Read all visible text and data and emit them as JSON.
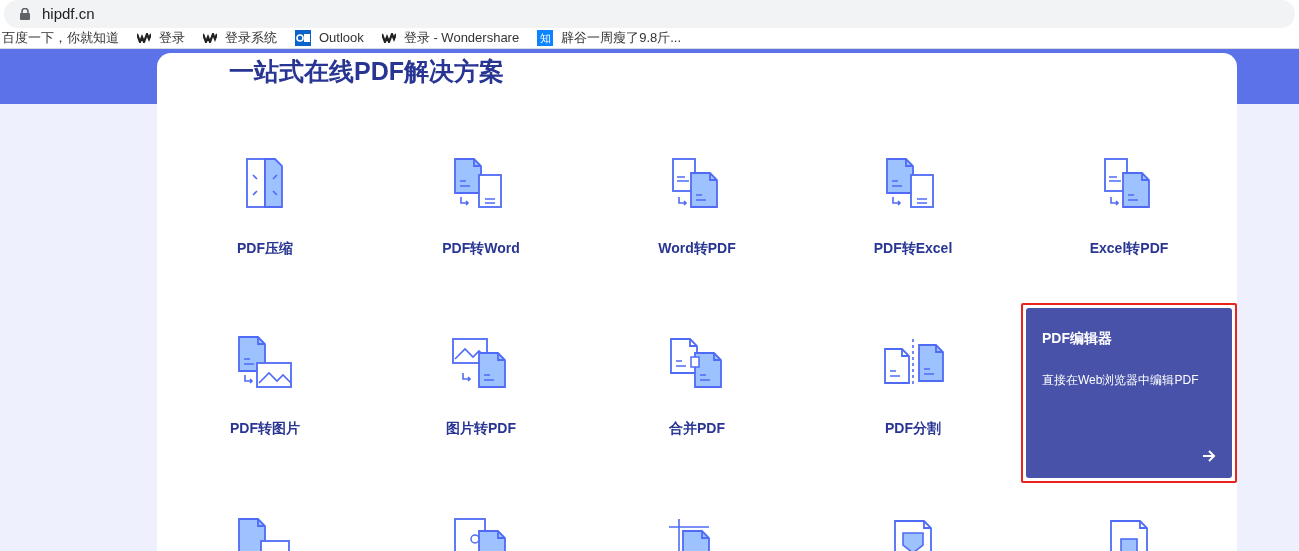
{
  "browser": {
    "url": "hipdf.cn",
    "bookmarks": [
      {
        "label": "百度一下，你就知道",
        "kind": "plain"
      },
      {
        "label": "登录",
        "kind": "w"
      },
      {
        "label": "登录系统",
        "kind": "w"
      },
      {
        "label": "Outlook",
        "kind": "mail"
      },
      {
        "label": "登录 - Wondershare",
        "kind": "w"
      },
      {
        "label": "辟谷一周瘦了9.8斤...",
        "kind": "zhi",
        "zhi": "知"
      }
    ]
  },
  "page": {
    "title": "一站式在线PDF解决方案",
    "tools": [
      {
        "label": "PDF压缩",
        "kind": "compress"
      },
      {
        "label": "PDF转Word",
        "kind": "to-word"
      },
      {
        "label": "Word转PDF",
        "kind": "from-word"
      },
      {
        "label": "PDF转Excel",
        "kind": "to-excel"
      },
      {
        "label": "Excel转PDF",
        "kind": "from-excel"
      },
      {
        "label": "PDF转图片",
        "kind": "to-image"
      },
      {
        "label": "图片转PDF",
        "kind": "from-image"
      },
      {
        "label": "合并PDF",
        "kind": "merge"
      },
      {
        "label": "PDF分割",
        "kind": "split"
      },
      {
        "kind": "feature",
        "title": "PDF编辑器",
        "description": "直接在Web浏览器中编辑PDF",
        "highlighted": true
      }
    ]
  }
}
